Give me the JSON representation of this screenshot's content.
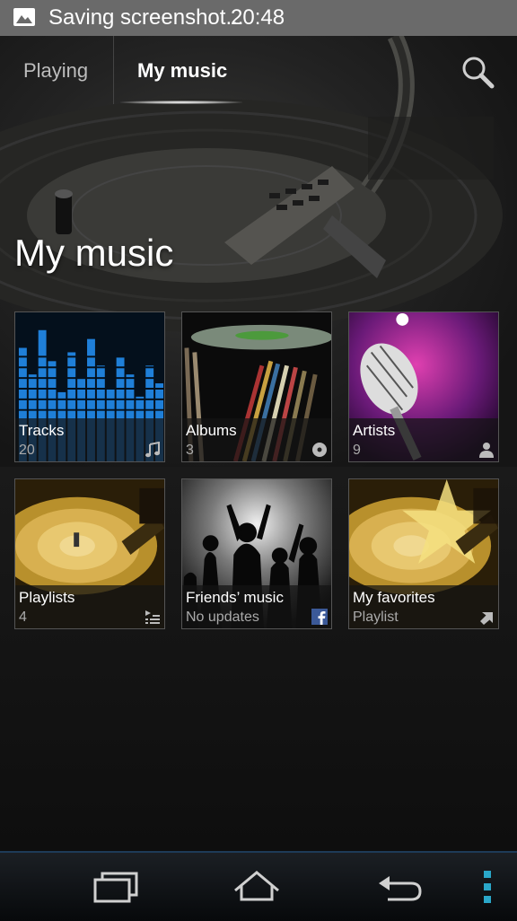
{
  "status_bar": {
    "notification_text": "Saving screenshot...",
    "time": "20:48",
    "notification_icon": "image-icon"
  },
  "tabs": [
    {
      "label": "Playing",
      "selected": false
    },
    {
      "label": "My music",
      "selected": true
    }
  ],
  "search": {
    "icon": "search-icon"
  },
  "page_title": "My music",
  "tiles": [
    {
      "label": "Tracks",
      "sub": "20",
      "icon": "music-note-icon"
    },
    {
      "label": "Albums",
      "sub": "3",
      "icon": "disc-icon"
    },
    {
      "label": "Artists",
      "sub": "9",
      "icon": "person-icon"
    },
    {
      "label": "Playlists",
      "sub": "4",
      "icon": "playlist-icon"
    },
    {
      "label": "Friends’ music",
      "sub": "No updates",
      "icon": "facebook-icon"
    },
    {
      "label": "My favorites",
      "sub": "Playlist",
      "icon": "shortcut-arrow-icon"
    }
  ],
  "nav_bar": {
    "recent": "recent-apps-icon",
    "home": "home-icon",
    "back": "back-icon",
    "menu": "overflow-menu-icon"
  },
  "colors": {
    "accent": "#2aa7c9",
    "status_bar": "#6a6a6a",
    "facebook": "#3b5998"
  }
}
